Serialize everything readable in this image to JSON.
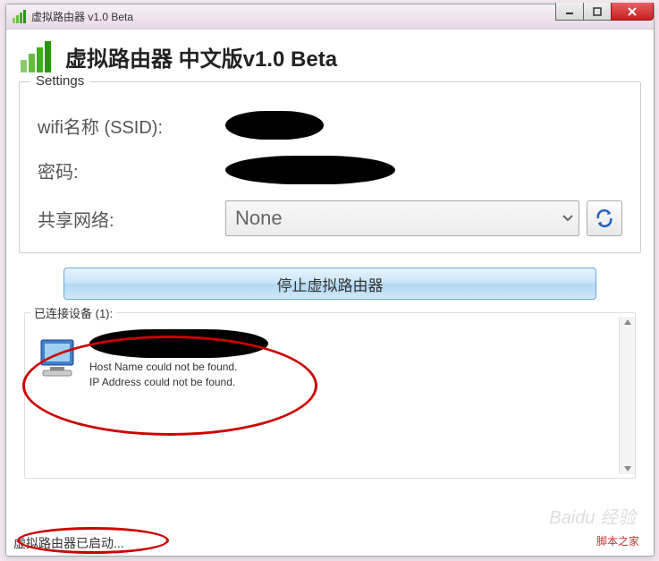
{
  "window": {
    "title": "虚拟路由器 v1.0 Beta"
  },
  "header": {
    "title": "虚拟路由器 中文版v1.0 Beta"
  },
  "settings": {
    "legend": "Settings",
    "ssid_label": "wifi名称 (SSID):",
    "password_label": "密码:",
    "share_label": "共享网络:",
    "share_value": "None"
  },
  "actions": {
    "stop_label": "停止虚拟路由器"
  },
  "devices": {
    "legend": "已连接设备 (1):",
    "items": [
      {
        "hostname_msg": "Host Name could not be found.",
        "ip_msg": "IP Address could not be found."
      }
    ]
  },
  "status": {
    "text": "虚拟路由器已启动..."
  },
  "watermarks": {
    "brand": "Baidu 经验",
    "source": "脚本之家"
  }
}
